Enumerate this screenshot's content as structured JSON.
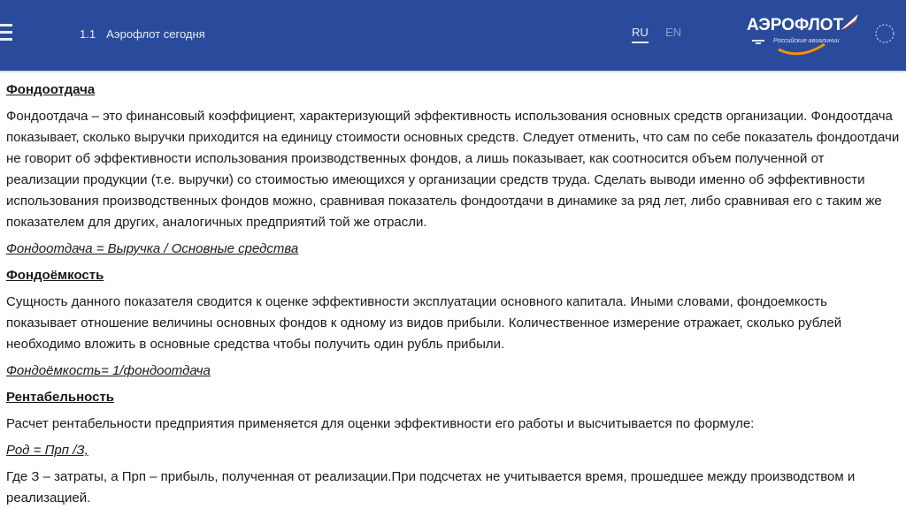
{
  "header": {
    "section_number": "1.1",
    "section_title": "Аэрофлот сегодня",
    "lang_ru": "RU",
    "lang_en": "EN",
    "logo_text": "АЭРОФЛОТ",
    "logo_subtitle": "Российские авиалинии",
    "bg_color": "#2a4b9c"
  },
  "content": {
    "h1": "Фондоотдача",
    "p1": "Фондоотдача – это финансовый коэффициент, характеризующий эффективность использования основных средств организации. Фондоотдача показывает, сколько выручки приходится на единицу стоимости основных средств. Следует отменить, что сам по себе показатель фондоотдачи не говорит об эффективности использования производственных фондов, а лишь показывает, как соотносится объем полученной от реализации продукции (т.е. выручки) со стоимостью имеющихся у организации средств труда. Сделать выводи именно об эффективности использования производственных фондов можно, сравнивая показатель фондоотдачи в динамике за ряд лет, либо сравнивая его с таким же показателем для других, аналогичных предприятий той же отрасли.",
    "f1": "Фондоотдача = Выручка / Основные средства",
    "h2": "Фондоёмкость",
    "p2": "Сущность данного показателя сводится к оценке эффективности эксплуатации основного капитала. Иными словами, фондоемкость показывает отношение величины основных фондов к одному из видов прибыли. Количественное измерение отражает, сколько рублей необходимо вложить в основные средства чтобы получить один рубль прибыли.",
    "f2": "Фондоёмкость= 1/фондоотдача",
    "h3": "Рентабельность",
    "p3": "Расчет рентабельности предприятия применяется для оценки эффективности его работы и высчитывается по формуле:",
    "f3": "Род = Прп /З,",
    "p4": "Где З – затраты, а Прп – прибыль, полученная от реализации.При подсчетах не учитывается время, прошедшее между производством и реализацией."
  }
}
